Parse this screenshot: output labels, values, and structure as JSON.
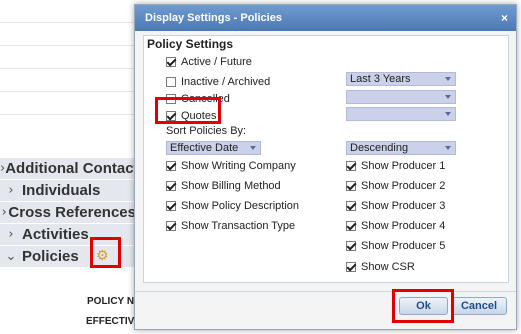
{
  "background": {
    "sections": [
      {
        "label": "Additional Contacts"
      },
      {
        "label": "Individuals"
      },
      {
        "label": "Cross References"
      },
      {
        "label": "Activities"
      },
      {
        "label": "Policies"
      }
    ],
    "table_labels": [
      "POLICY N",
      "EFFECTIV"
    ]
  },
  "dialog": {
    "title": "Display Settings - Policies",
    "close_glyph": "×",
    "heading": "Policy Settings",
    "status_options": [
      {
        "label": "Active / Future",
        "checked": true
      },
      {
        "label": "Inactive / Archived",
        "checked": false,
        "select_value": "Last 3 Years"
      },
      {
        "label": "Cancelled",
        "checked": false,
        "select_value": ""
      },
      {
        "label": "Quotes",
        "checked": true,
        "select_value": ""
      }
    ],
    "sort_label": "Sort Policies By:",
    "sort_field": "Effective Date",
    "sort_order": "Descending",
    "left_options": [
      {
        "label": "Show Writing Company",
        "checked": true
      },
      {
        "label": "Show Billing Method",
        "checked": true
      },
      {
        "label": "Show Policy Description",
        "checked": true
      },
      {
        "label": "Show Transaction Type",
        "checked": true
      }
    ],
    "right_options": [
      {
        "label": "Show Producer 1",
        "checked": true
      },
      {
        "label": "Show Producer 2",
        "checked": true
      },
      {
        "label": "Show Producer 3",
        "checked": true
      },
      {
        "label": "Show Producer 4",
        "checked": true
      },
      {
        "label": "Show Producer 5",
        "checked": true
      },
      {
        "label": "Show CSR",
        "checked": true
      }
    ],
    "ok_label": "Ok",
    "cancel_label": "Cancel"
  },
  "colors": {
    "highlight": "#e00000",
    "titlebar": "#5a86be",
    "select_bg": "#ccd1ea"
  }
}
